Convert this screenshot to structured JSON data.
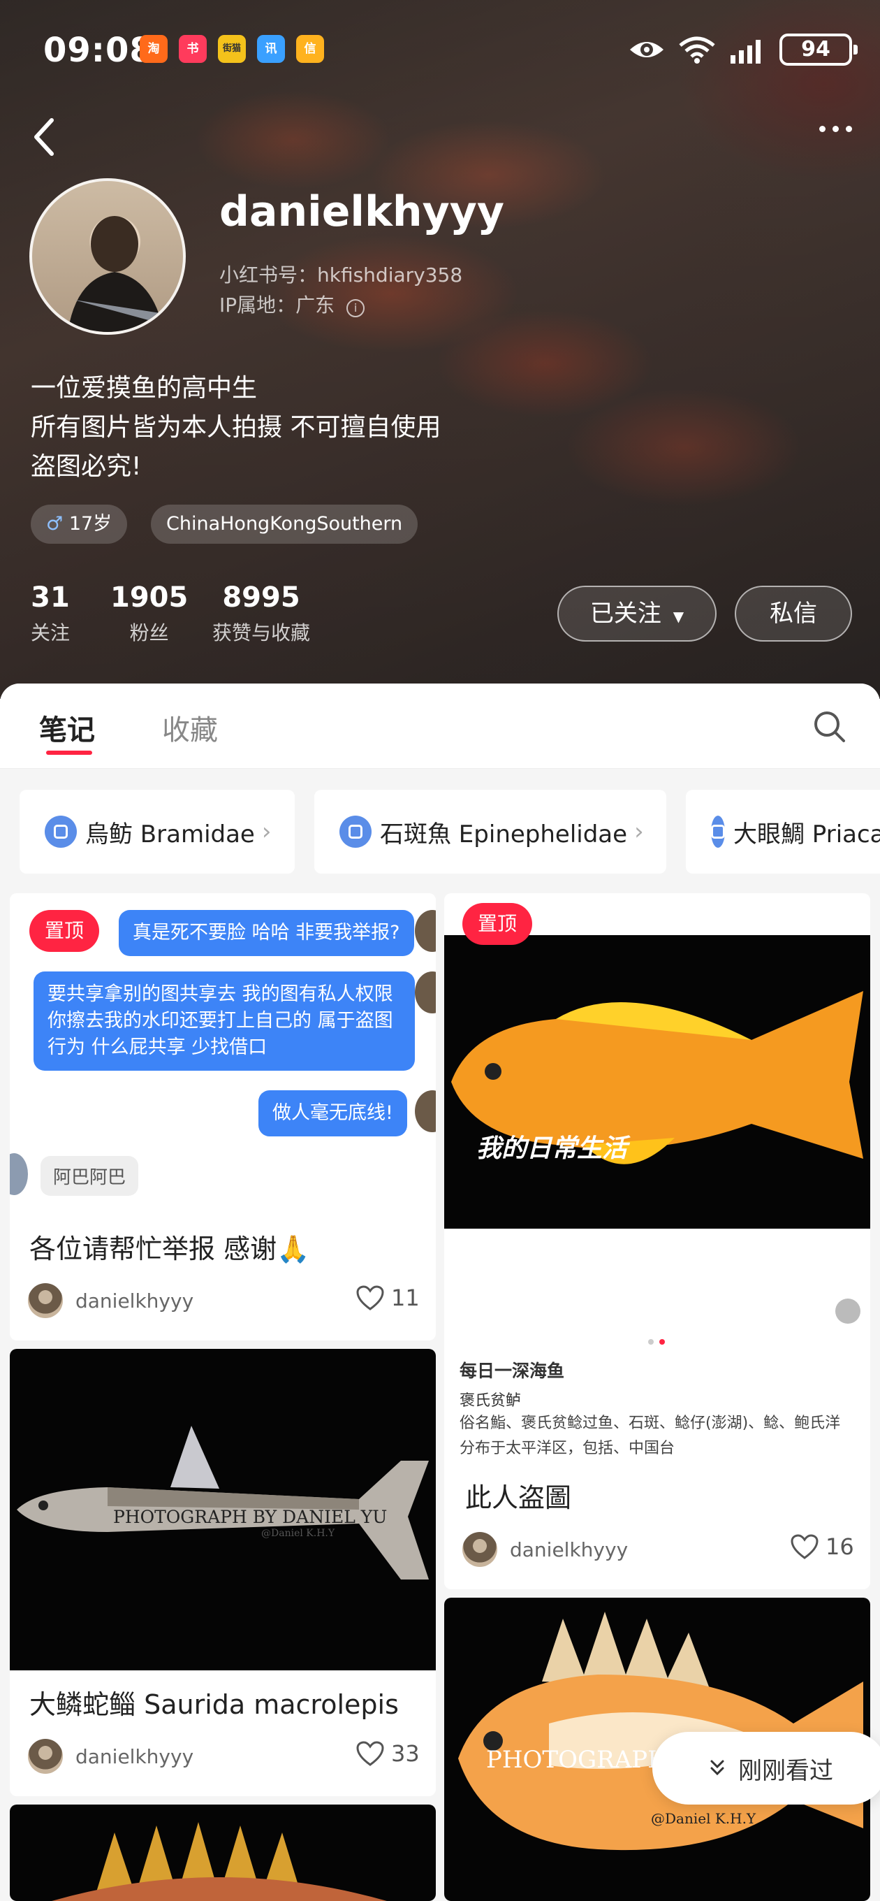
{
  "status_bar": {
    "time": "09:08",
    "battery": "94",
    "apps": [
      "淘",
      "书",
      "街猫",
      "讯",
      "信"
    ]
  },
  "profile": {
    "username": "danielkhyyy",
    "redbook_id": "小红书号：hkfishdiary358",
    "ip_location": "IP属地：广东",
    "bio": [
      "一位爱摸鱼的高中生",
      "所有图片皆为本人拍摄 不可擅自使用",
      "盗图必究!"
    ],
    "tags": [
      "17岁",
      "ChinaHongKongSouthern"
    ],
    "stats": [
      {
        "value": "31",
        "label": "关注"
      },
      {
        "value": "1905",
        "label": "粉丝"
      },
      {
        "value": "8995",
        "label": "获赞与收藏"
      }
    ],
    "follow_button": "已关注",
    "message_button": "私信"
  },
  "tabs": [
    "笔记",
    "收藏"
  ],
  "collections": [
    "烏鲂 Bramidae",
    "石斑魚 Epinephelidae",
    "大眼鯛 Priacanthidae"
  ],
  "posts": [
    {
      "pinned": "置顶",
      "chat": [
        "真是死不要脸 哈哈 非要我举报?",
        "要共享拿别的图共享去 我的图有私人权限 你擦去我的水印还要打上自己的 属于盗图 行为 什么屁共享 少找借口",
        "做人毫无底线!"
      ],
      "chat_name": "阿巴阿巴",
      "title": "各位请帮忙举报 感谢🙏",
      "author": "danielkhyyy",
      "likes": "11"
    },
    {
      "pinned": "置顶",
      "overlay": "我的日常生活",
      "source": "每日一深海鱼",
      "species": "褒氏贫鲈",
      "desc_lines": [
        "俗名鮨、褒氏贫鲶过鱼、石斑、鲶仔(澎湖)、鲶、鲍氏洋",
        "分布于太平洋区，包括、中国台"
      ],
      "title": "此人盗圖",
      "author": "danielkhyyy",
      "likes": "16"
    },
    {
      "watermark": "PHOTOGRAPH BY DANIEL YU",
      "watermark_small": "@Daniel K.H.Y",
      "title": "大鳞蛇鲻 Saurida macrolepis",
      "author": "danielkhyyy",
      "likes": "33"
    },
    {
      "watermark": "PHOTOGRAPH",
      "watermark_small": "@Daniel K.H.Y"
    }
  ],
  "floating_button": "刚刚看过",
  "colors": {
    "accent": "#ff2442",
    "bubble": "#3d84f7",
    "collection_icon": "#5a8de8"
  }
}
